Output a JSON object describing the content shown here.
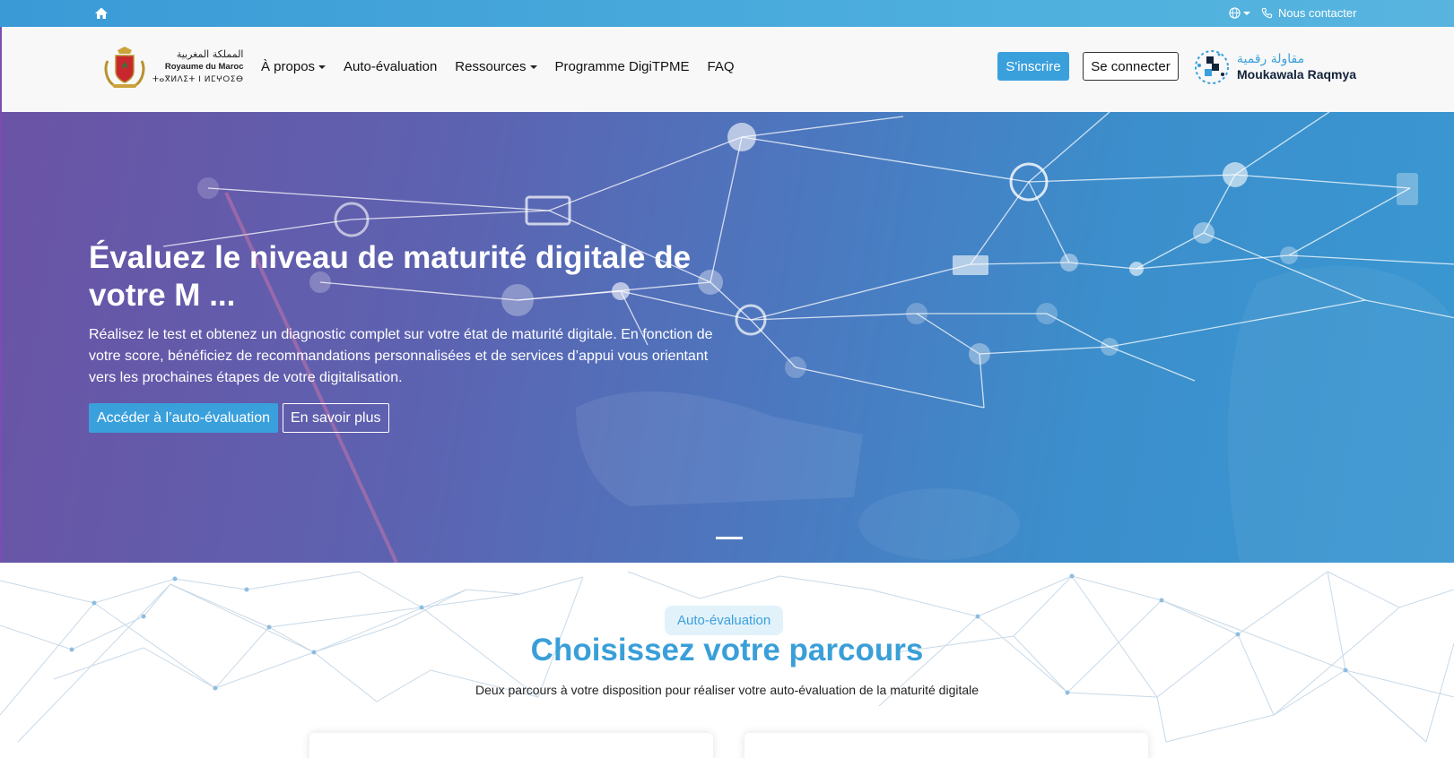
{
  "topbar": {
    "contact_label": "Nous contacter",
    "icons": [
      "home-icon",
      "globe-icon",
      "phone-icon"
    ]
  },
  "navbar": {
    "gov_logo": {
      "arabic": "المملكة المغربية",
      "french": "Royaume du Maroc",
      "tifinagh": "ⵜⴰⴳⵍⴷⵉⵜ ⵏ ⵍⵎⵖⵔⵉⴱ"
    },
    "menu": [
      {
        "label": "À propos",
        "dropdown": true
      },
      {
        "label": "Auto-évaluation",
        "dropdown": false
      },
      {
        "label": "Ressources",
        "dropdown": true
      },
      {
        "label": "Programme DigiTPME",
        "dropdown": false
      },
      {
        "label": "FAQ",
        "dropdown": false
      }
    ],
    "signup_label": "S'inscrire",
    "login_label": "Se connecter",
    "brand_logo": {
      "arabic": "مقاولة رقمية",
      "latin": "Moukawala Raqmya"
    }
  },
  "hero": {
    "title": "Évaluez le niveau de maturité digitale de votre M ...",
    "description": "Réalisez le test et obtenez un diagnostic complet sur votre état de maturité digitale. En fonction de votre score, bénéficiez de recommandations personnalisées et de services d’appui vous orientant vers les prochaines étapes de votre digitalisation.",
    "primary_button": "Accéder à l’auto-évaluation",
    "secondary_button": "En savoir plus"
  },
  "section": {
    "pill": "Auto-évaluation",
    "title": "Choisissez votre parcours",
    "subtitle": "Deux parcours à votre disposition pour réaliser votre auto-évaluation de la maturité digitale"
  },
  "colors": {
    "accent": "#3aa0dc",
    "hero_start": "#6b53a5",
    "hero_end": "#3a97d1",
    "title_blue": "#3a9fd8"
  }
}
